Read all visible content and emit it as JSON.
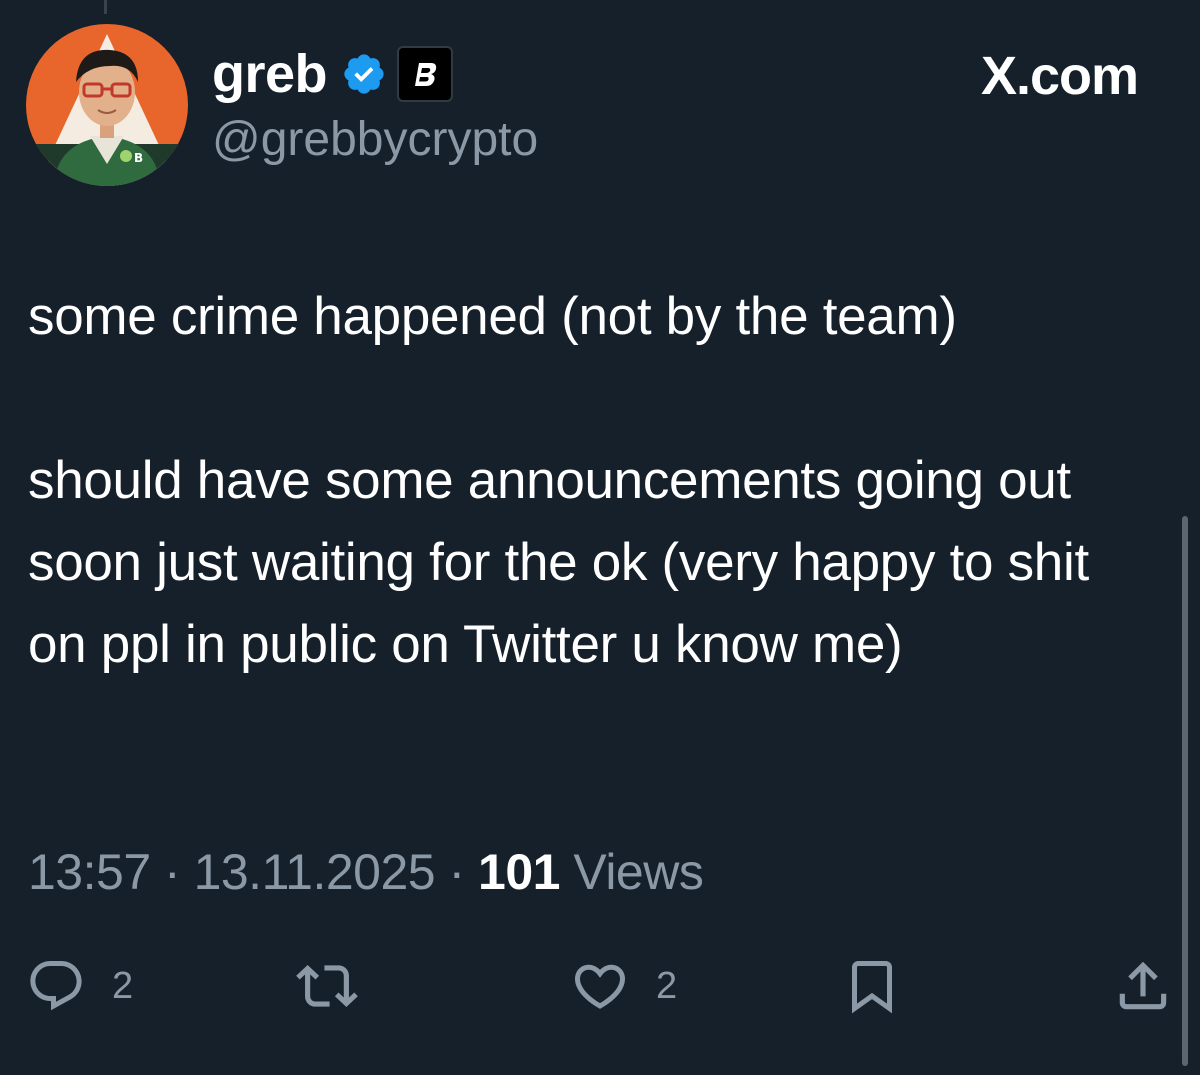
{
  "author": {
    "display_name": "greb",
    "handle": "@grebbycrypto",
    "verified_icon": "verified-badge-icon",
    "affiliate_icon": "affiliate-logo-icon"
  },
  "brand": {
    "label": "X.com"
  },
  "tweet": {
    "paragraph_1": "some crime happened (not by the team)",
    "paragraph_2": "should have some announcements going out soon just waiting for the ok (very happy to shit on ppl in public on Twitter u know me)"
  },
  "meta": {
    "time": "13:57",
    "separator_1": " · ",
    "date": "13.11.2025",
    "separator_2": " · ",
    "views_count": "101",
    "views_label": " Views"
  },
  "actions": {
    "reply_count": "2",
    "like_count": "2"
  },
  "colors": {
    "background": "#15202b",
    "secondary_text": "#8b98a5",
    "verified_blue": "#1d9bf0"
  }
}
